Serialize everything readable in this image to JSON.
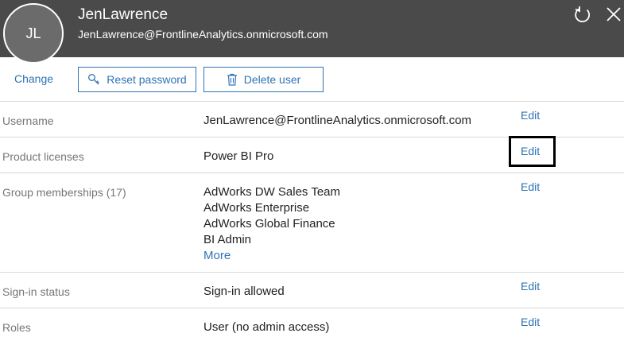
{
  "header": {
    "avatar_initials": "JL",
    "name": "JenLawrence",
    "email": "JenLawrence@FrontlineAnalytics.onmicrosoft.com"
  },
  "actions": {
    "change_label": "Change",
    "reset_password_label": "Reset password",
    "delete_user_label": "Delete user"
  },
  "details": {
    "username": {
      "label": "Username",
      "value": "JenLawrence@FrontlineAnalytics.onmicrosoft.com",
      "edit": "Edit"
    },
    "licenses": {
      "label": "Product licenses",
      "value": "Power BI Pro",
      "edit": "Edit"
    },
    "groups": {
      "label": "Group memberships (17)",
      "items": [
        "AdWorks DW Sales Team",
        "AdWorks Enterprise",
        "AdWorks Global Finance",
        "BI Admin"
      ],
      "more": "More",
      "edit": "Edit"
    },
    "signin": {
      "label": "Sign-in status",
      "value": "Sign-in allowed",
      "edit": "Edit"
    },
    "roles": {
      "label": "Roles",
      "value": "User (no admin access)",
      "edit": "Edit"
    }
  },
  "colors": {
    "header_bg": "#4a4a4a",
    "link": "#2f73b5"
  },
  "icons": [
    "refresh-icon",
    "close-icon",
    "key-icon",
    "trash-icon"
  ]
}
